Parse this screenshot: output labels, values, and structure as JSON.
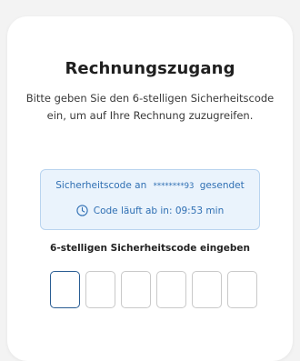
{
  "card": {
    "title": "Rechnungszugang",
    "subtitle": "Bitte geben Sie den 6-stelligen Sicherheitscode ein, um auf Ihre Rechnung zuzugreifen."
  },
  "info": {
    "sent_prefix": "Sicherheitscode an",
    "masked_number": "********93",
    "sent_suffix": "gesendet",
    "expiry_text": "Code läuft ab in: 09:53 min",
    "icon": "clock-icon",
    "color": "#2f6fb3"
  },
  "code_entry": {
    "label": "6-stelligen Sicherheitscode eingeben",
    "digits": [
      "",
      "",
      "",
      "",
      "",
      ""
    ]
  }
}
